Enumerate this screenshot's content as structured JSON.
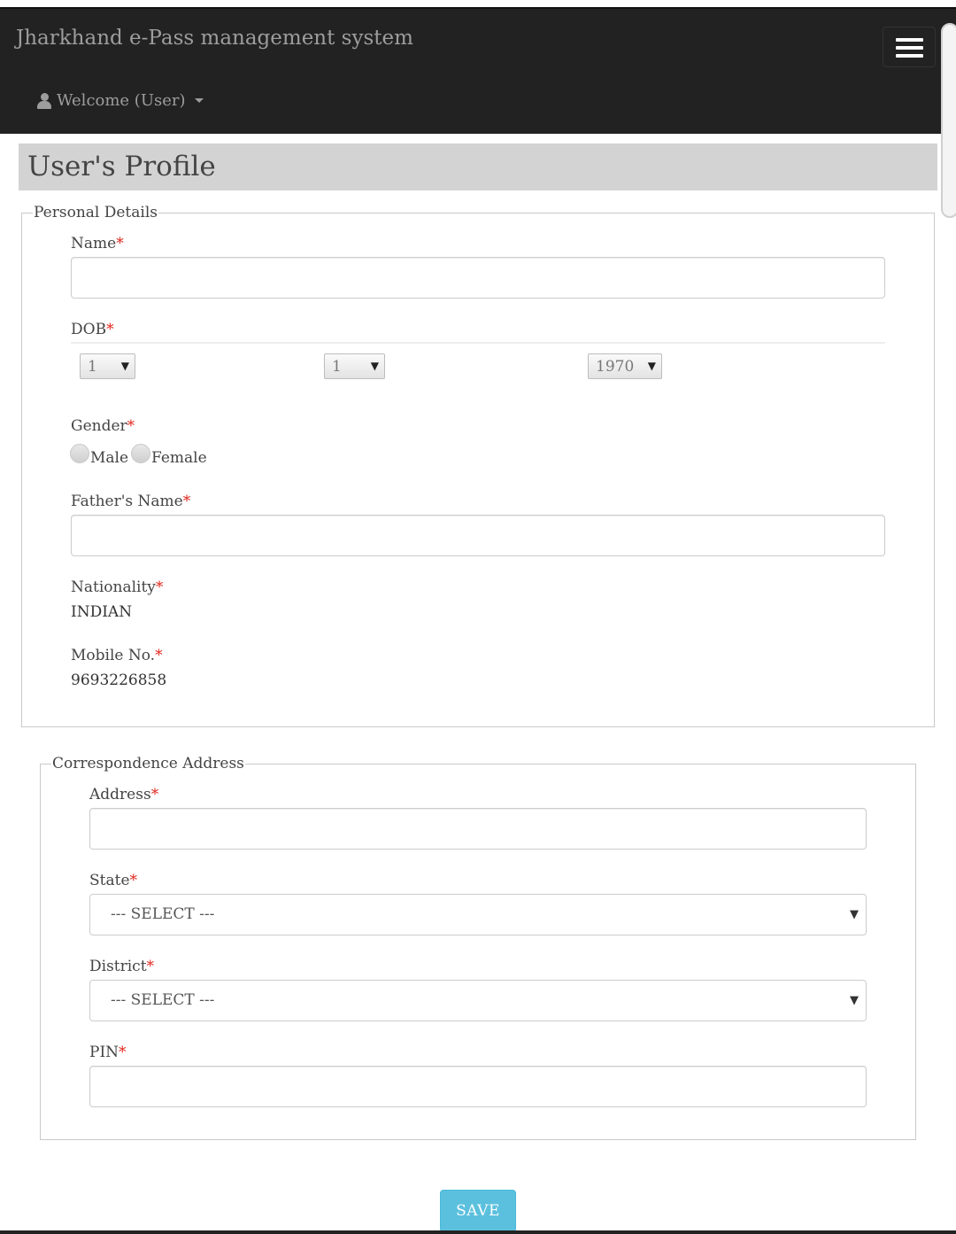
{
  "navbar": {
    "brand": "Jharkhand e-Pass management system",
    "welcome": "Welcome (User)"
  },
  "page": {
    "title": "User's Profile"
  },
  "personal_details": {
    "legend": "Personal Details",
    "name_label": "Name",
    "dob_label": "DOB",
    "dob_day": "1",
    "dob_month": "1",
    "dob_year": "1970",
    "gender_label": "Gender",
    "gender_options": [
      "Male",
      "Female"
    ],
    "father_name_label": "Father's Name",
    "nationality_label": "Nationality",
    "nationality_value": "INDIAN",
    "mobile_label": "Mobile No.",
    "mobile_value": "9693226858",
    "required_mark": "*"
  },
  "correspondence_address": {
    "legend": "Correspondence Address",
    "address_label": "Address",
    "state_label": "State",
    "state_selected": "--- SELECT ---",
    "district_label": "District",
    "district_selected": "--- SELECT ---",
    "pin_label": "PIN"
  },
  "actions": {
    "save_label": "SAVE"
  },
  "colors": {
    "navbar_bg": "#222222",
    "title_bar_bg": "#d3d3d3",
    "required": "#e0271d",
    "save_button": "#5bc0de"
  },
  "icons": [
    "user-icon",
    "caret-down-icon",
    "hamburger-menu-icon",
    "select-arrow-icon"
  ]
}
